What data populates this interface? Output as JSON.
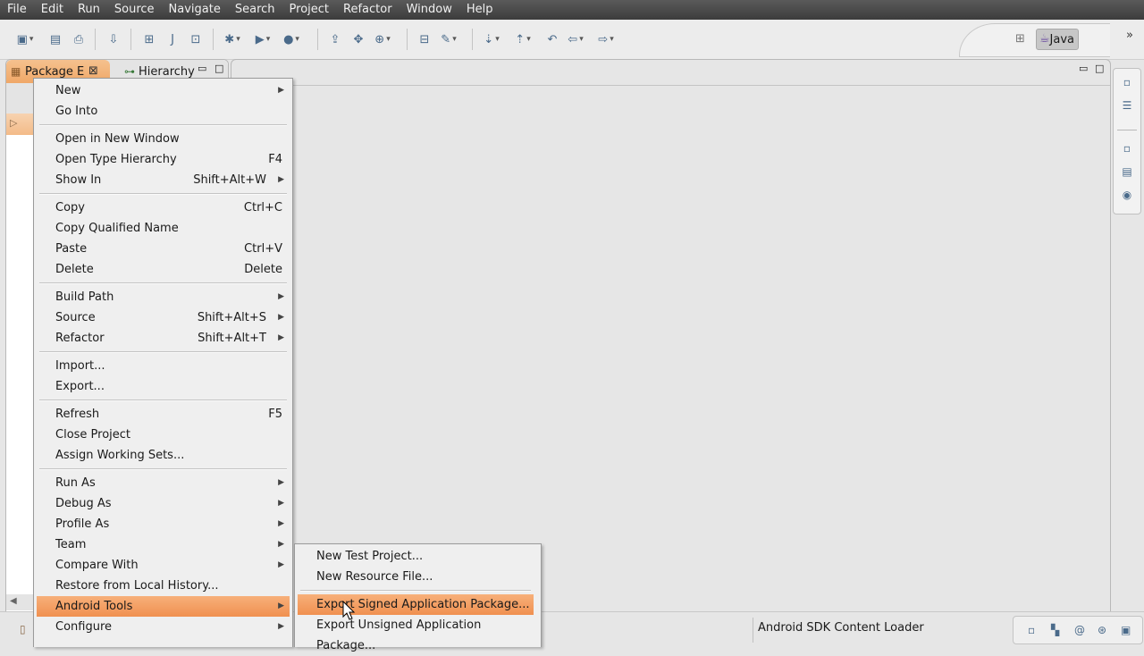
{
  "menubar": [
    "File",
    "Edit",
    "Run",
    "Source",
    "Navigate",
    "Search",
    "Project",
    "Refactor",
    "Window",
    "Help"
  ],
  "perspective": {
    "label": "Java"
  },
  "left_view": {
    "tabs": [
      {
        "label": "Package E"
      },
      {
        "label": "Hierarchy"
      }
    ]
  },
  "context_menu": {
    "items": [
      {
        "label": "New",
        "submenu": true
      },
      {
        "label": "Go Into"
      },
      {
        "sep": true
      },
      {
        "label": "Open in New Window"
      },
      {
        "label": "Open Type Hierarchy",
        "shortcut": "F4"
      },
      {
        "label": "Show In",
        "shortcut": "Shift+Alt+W",
        "submenu": true
      },
      {
        "sep": true
      },
      {
        "label": "Copy",
        "shortcut": "Ctrl+C"
      },
      {
        "label": "Copy Qualified Name"
      },
      {
        "label": "Paste",
        "shortcut": "Ctrl+V"
      },
      {
        "label": "Delete",
        "shortcut": "Delete"
      },
      {
        "sep": true
      },
      {
        "label": "Build Path",
        "submenu": true
      },
      {
        "label": "Source",
        "shortcut": "Shift+Alt+S",
        "submenu": true
      },
      {
        "label": "Refactor",
        "shortcut": "Shift+Alt+T",
        "submenu": true
      },
      {
        "sep": true
      },
      {
        "label": "Import..."
      },
      {
        "label": "Export..."
      },
      {
        "sep": true
      },
      {
        "label": "Refresh",
        "shortcut": "F5"
      },
      {
        "label": "Close Project"
      },
      {
        "label": "Assign Working Sets..."
      },
      {
        "sep": true
      },
      {
        "label": "Run As",
        "submenu": true
      },
      {
        "label": "Debug As",
        "submenu": true
      },
      {
        "label": "Profile As",
        "submenu": true
      },
      {
        "label": "Team",
        "submenu": true
      },
      {
        "label": "Compare With",
        "submenu": true
      },
      {
        "label": "Restore from Local History..."
      },
      {
        "label": "Android Tools",
        "submenu": true,
        "highlighted": true
      },
      {
        "label": "Configure",
        "submenu": true
      }
    ]
  },
  "submenu": {
    "items": [
      {
        "label": "New Test Project..."
      },
      {
        "label": "New Resource File..."
      },
      {
        "sep": true
      },
      {
        "label": "Export Signed Application Package...",
        "highlighted": true
      },
      {
        "label": "Export Unsigned Application Package..."
      }
    ]
  },
  "status": {
    "text": "Android SDK Content Loader"
  },
  "colors": {
    "highlight": "#f09a5a",
    "menubar": "#4a4a4a",
    "tab_active": "#f3b074"
  }
}
